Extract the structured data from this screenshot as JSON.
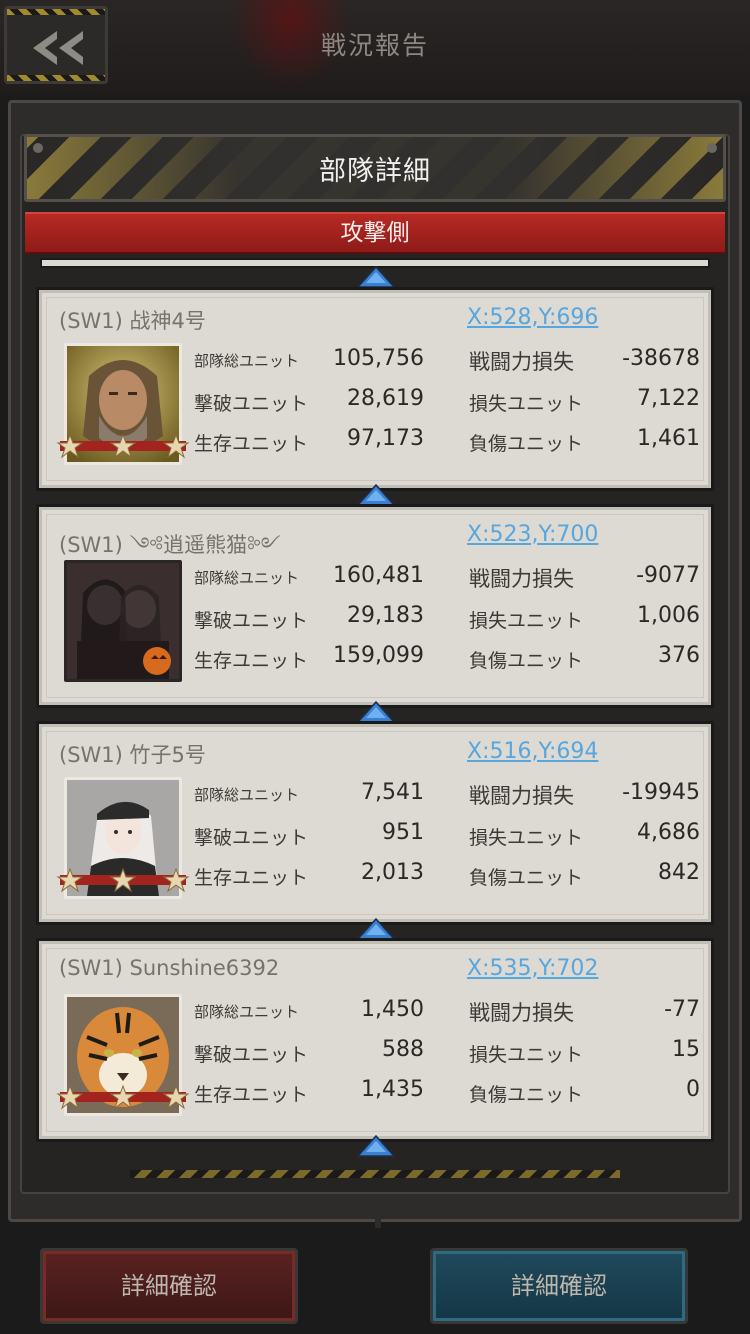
{
  "screen_title": "戦況報告",
  "panel_title": "部隊詳細",
  "side_label": "攻撃側",
  "labels": {
    "total_units": "部隊総ユニット",
    "destroyed_units": "撃破ユニット",
    "surviving_units": "生存ユニット",
    "power_loss": "戦闘力損失",
    "lost_units": "損失ユニット",
    "wounded_units": "負傷ユニット"
  },
  "players": [
    {
      "name": "(SW1) 战神4号",
      "coord": "X:528,Y:696",
      "total_units": "105,756",
      "destroyed_units": "28,619",
      "surviving_units": "97,173",
      "power_loss": "-38678",
      "lost_units": "7,122",
      "wounded_units": "1,461",
      "avatar": "bearded-man-portrait"
    },
    {
      "name": "(SW1) ༺逍遥熊猫༻",
      "coord": "X:523,Y:700",
      "total_units": "160,481",
      "destroyed_units": "29,183",
      "surviving_units": "159,099",
      "power_loss": "-9077",
      "lost_units": "1,006",
      "wounded_units": "376",
      "avatar": "dark-couple-portrait"
    },
    {
      "name": "(SW1) 竹子5号",
      "coord": "X:516,Y:694",
      "total_units": "7,541",
      "destroyed_units": "951",
      "surviving_units": "2,013",
      "power_loss": "-19945",
      "lost_units": "4,686",
      "wounded_units": "842",
      "avatar": "anime-girl-portrait"
    },
    {
      "name": "(SW1) Sunshine6392",
      "coord": "X:535,Y:702",
      "total_units": "1,450",
      "destroyed_units": "588",
      "surviving_units": "1,435",
      "power_loss": "-77",
      "lost_units": "15",
      "wounded_units": "0",
      "avatar": "tiger-portrait"
    }
  ],
  "buttons": {
    "left": "詳細確認",
    "right": "詳細確認"
  },
  "colors": {
    "accent_red": "#a32420",
    "link_blue": "#58a6de",
    "card_bg": "#dddad3"
  }
}
